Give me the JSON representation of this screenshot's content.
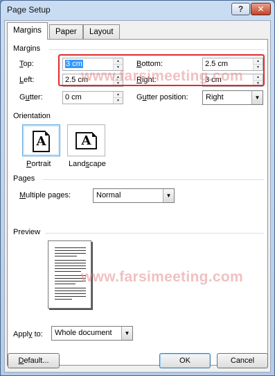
{
  "window": {
    "title": "Page Setup",
    "help_symbol": "?",
    "close_symbol": "✕"
  },
  "tabs": [
    {
      "label": "Margins",
      "active": true
    },
    {
      "label": "Paper",
      "active": false
    },
    {
      "label": "Layout",
      "active": false
    }
  ],
  "margins": {
    "group_label": "Margins",
    "top": {
      "label_key": "T",
      "label_rest": "op:",
      "value": "3 cm"
    },
    "bottom": {
      "label_key": "B",
      "label_rest": "ottom:",
      "value": "2.5 cm"
    },
    "left": {
      "label_key": "L",
      "label_rest": "eft:",
      "value": "2.5 cm"
    },
    "right": {
      "label_key": "R",
      "label_rest": "ight:",
      "value": "3 cm"
    },
    "gutter": {
      "label_pre": "G",
      "label_key": "u",
      "label_rest": "tter:",
      "value": "0 cm"
    },
    "gutter_position": {
      "label_pre": "G",
      "label_key": "u",
      "label_rest": "tter position:",
      "value": "Right"
    }
  },
  "orientation": {
    "group_label": "Orientation",
    "portrait_label_key": "P",
    "portrait_label_rest": "ortrait",
    "landscape_label_pre": "Land",
    "landscape_label_key": "s",
    "landscape_label_rest": "cape",
    "icon_glyph": "A",
    "selected": "portrait"
  },
  "pages": {
    "group_label": "Pages",
    "multiple_label_key": "M",
    "multiple_label_rest": "ultiple pages:",
    "multiple_value": "Normal"
  },
  "preview": {
    "group_label": "Preview",
    "apply_label_pre": "Appl",
    "apply_label_key": "y",
    "apply_label_rest": " to:",
    "apply_value": "Whole document"
  },
  "footer": {
    "default_pre": "",
    "default_key": "D",
    "default_rest": "efault...",
    "ok": "OK",
    "cancel": "Cancel"
  },
  "watermark": "www.farsimeeting.com",
  "colors": {
    "highlight": "#e02b2b",
    "selection": "#3399ff",
    "watermark": "#e68c8c"
  }
}
